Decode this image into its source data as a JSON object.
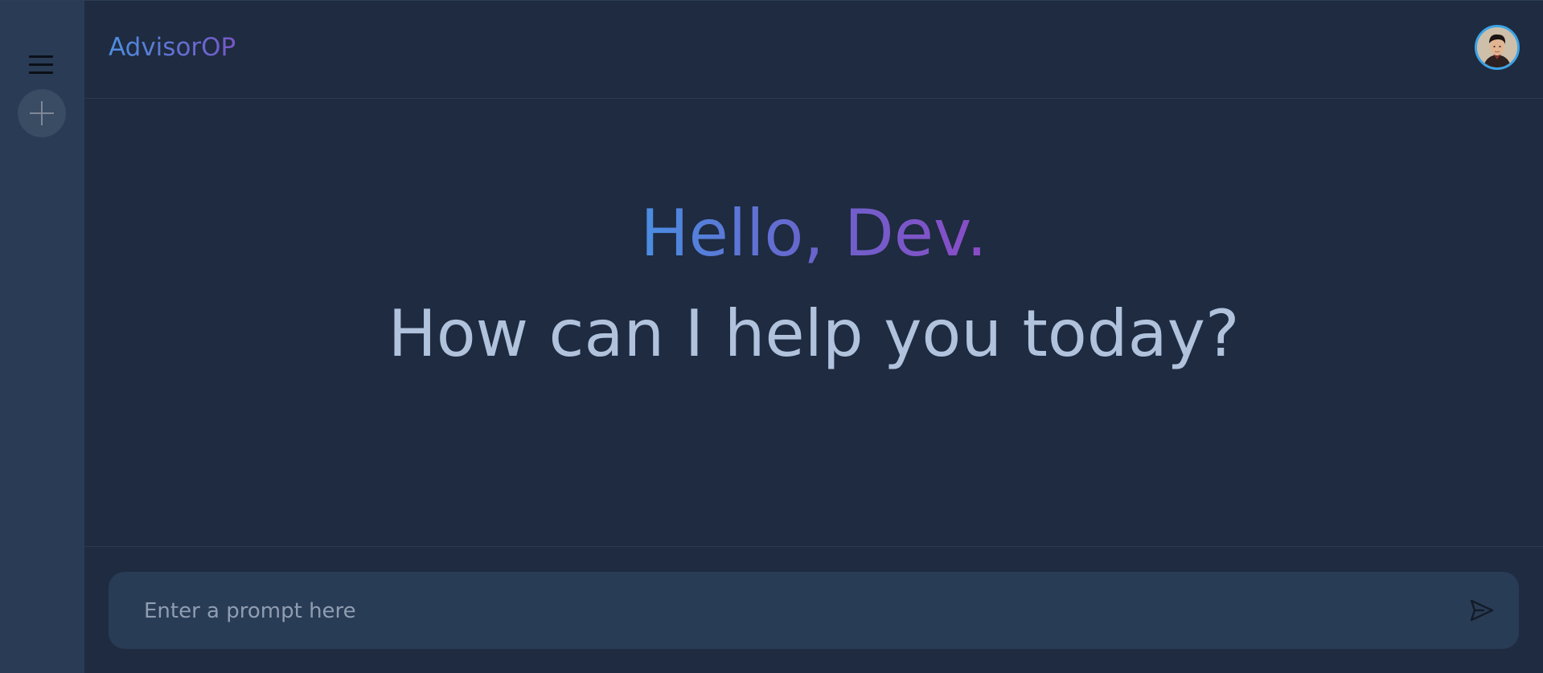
{
  "app": {
    "brand": "AdvisorOP"
  },
  "greeting": {
    "hello": "Hello, Dev.",
    "subtitle": "How can I help you today?"
  },
  "prompt": {
    "placeholder": "Enter a prompt here",
    "value": ""
  },
  "icons": {
    "menu": "hamburger-menu-icon",
    "new_chat": "plus-icon",
    "send": "send-icon",
    "avatar": "user-avatar"
  },
  "colors": {
    "background": "#1e2b40",
    "sidebar": "#293b55",
    "brand_gradient_start": "#4c8fe0",
    "brand_gradient_end": "#7757c8",
    "avatar_ring": "#3ca3e6",
    "subtitle_text": "#b1c2dc",
    "prompt_bg": "#293c55"
  }
}
